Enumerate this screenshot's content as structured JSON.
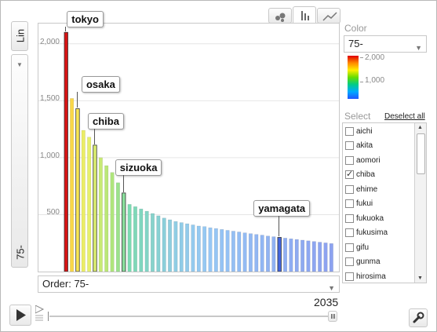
{
  "y_axis_menu": {
    "top_label": "Lin",
    "bottom_label": "75-"
  },
  "order_menu": {
    "label": "Order: 75-"
  },
  "color_panel": {
    "title": "Color",
    "value": "75-",
    "legend_max": "2,000",
    "legend_mid": "1,000"
  },
  "select_panel": {
    "title": "Select",
    "deselect_all": "Deselect all",
    "items": [
      {
        "label": "aichi",
        "checked": false
      },
      {
        "label": "akita",
        "checked": false
      },
      {
        "label": "aomori",
        "checked": false
      },
      {
        "label": "chiba",
        "checked": true
      },
      {
        "label": "ehime",
        "checked": false
      },
      {
        "label": "fukui",
        "checked": false
      },
      {
        "label": "fukuoka",
        "checked": false
      },
      {
        "label": "fukusima",
        "checked": false
      },
      {
        "label": "gifu",
        "checked": false
      },
      {
        "label": "gunma",
        "checked": false
      },
      {
        "label": "hirosima",
        "checked": false
      }
    ]
  },
  "playback": {
    "year": "2035"
  },
  "colors": {
    "accent": "#0066cc",
    "grid": "#e6e6e6"
  },
  "chart_data": {
    "type": "bar",
    "ylim": [
      0,
      2150
    ],
    "yticks": [
      "2,000",
      "1,500",
      "1,000",
      "500"
    ],
    "ytick_values": [
      2000,
      1500,
      1000,
      500
    ],
    "values": [
      2100,
      1520,
      1430,
      1240,
      1180,
      1110,
      1000,
      930,
      870,
      780,
      690,
      590,
      570,
      550,
      530,
      510,
      490,
      470,
      455,
      440,
      430,
      420,
      410,
      400,
      395,
      385,
      378,
      370,
      362,
      355,
      348,
      340,
      333,
      326,
      320,
      312,
      306,
      300,
      294,
      288,
      282,
      276,
      270,
      264,
      258,
      252,
      246
    ],
    "annotations": [
      {
        "index": 0,
        "label": "tokyo"
      },
      {
        "index": 2,
        "label": "osaka"
      },
      {
        "index": 5,
        "label": "chiba"
      },
      {
        "index": 10,
        "label": "sizuoka"
      },
      {
        "index": 37,
        "label": "yamagata"
      }
    ]
  }
}
